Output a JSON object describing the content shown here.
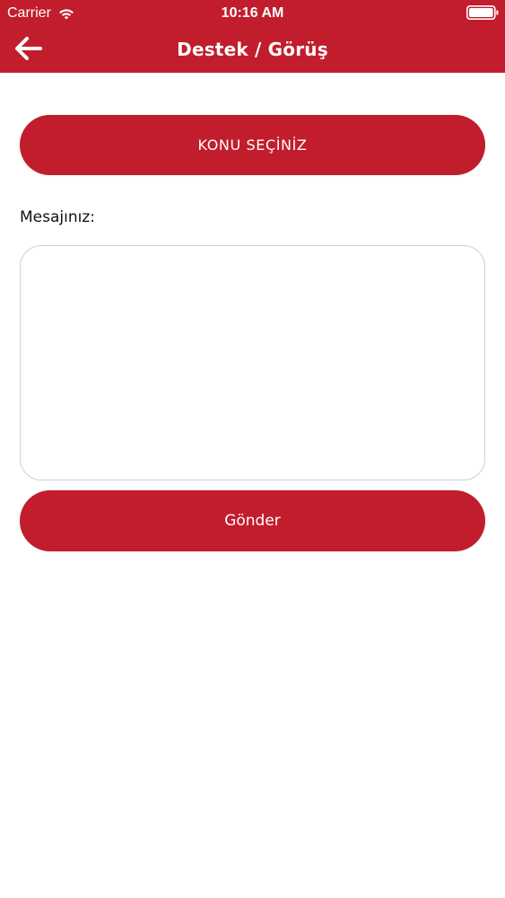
{
  "status_bar": {
    "carrier": "Carrier",
    "time": "10:16 AM",
    "wifi_icon": "wifi-icon",
    "battery_icon": "battery-icon"
  },
  "nav": {
    "title": "Destek / Görüş",
    "back_icon": "arrow-left-icon"
  },
  "form": {
    "subject_button_label": "KONU SEÇİNİZ",
    "message_label": "Mesajınız:",
    "message_value": "",
    "message_placeholder": "",
    "send_button_label": "Gönder"
  },
  "colors": {
    "brand_red": "#c21d2c",
    "background": "#ffffff",
    "border": "#cfcfcf",
    "text_dark": "#111111",
    "text_light": "#ffffff"
  }
}
